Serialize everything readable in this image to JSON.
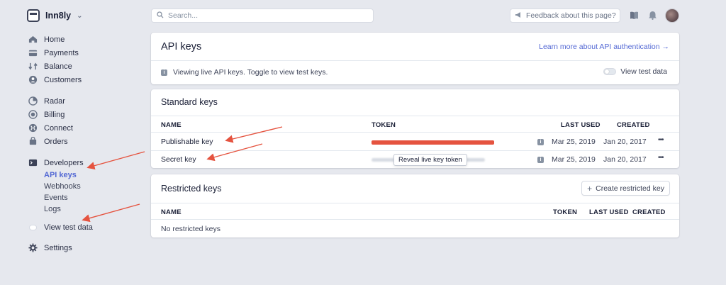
{
  "account": {
    "name": "Inn8ly"
  },
  "sidebar": {
    "primary": [
      {
        "label": "Home",
        "icon": "home-icon"
      },
      {
        "label": "Payments",
        "icon": "payments-icon"
      },
      {
        "label": "Balance",
        "icon": "balance-icon"
      },
      {
        "label": "Customers",
        "icon": "customers-icon"
      }
    ],
    "secondary": [
      {
        "label": "Radar",
        "icon": "radar-icon"
      },
      {
        "label": "Billing",
        "icon": "billing-icon"
      },
      {
        "label": "Connect",
        "icon": "connect-icon"
      },
      {
        "label": "Orders",
        "icon": "orders-icon"
      }
    ],
    "developers": {
      "label": "Developers",
      "children": [
        "API keys",
        "Webhooks",
        "Events",
        "Logs"
      ],
      "active_child": "API keys"
    },
    "view_test_data": "View test data",
    "settings": "Settings"
  },
  "topbar": {
    "search_placeholder": "Search...",
    "feedback": "Feedback about this page?"
  },
  "api_keys_card": {
    "title": "API keys",
    "learn_more": "Learn more about API authentication →",
    "notice": "Viewing live API keys. Toggle to view test keys.",
    "toggle_label": "View test data"
  },
  "standard_keys": {
    "title": "Standard keys",
    "columns": [
      "NAME",
      "TOKEN",
      "LAST USED",
      "CREATED"
    ],
    "rows": [
      {
        "name": "Publishable key",
        "last_used": "Mar 25, 2019",
        "created": "Jan 20, 2017"
      },
      {
        "name": "Secret key",
        "last_used": "Mar 25, 2019",
        "created": "Jan 20, 2017"
      }
    ],
    "reveal_tooltip": "Reveal live key token"
  },
  "restricted_keys": {
    "title": "Restricted keys",
    "create_button": "Create restricted key",
    "columns": [
      "NAME",
      "TOKEN",
      "LAST USED",
      "CREATED"
    ],
    "empty": "No restricted keys"
  },
  "colors": {
    "background": "#e6e8ee",
    "accent": "#5469d4",
    "annotation": "#e5533f",
    "text": "#3c4257"
  }
}
